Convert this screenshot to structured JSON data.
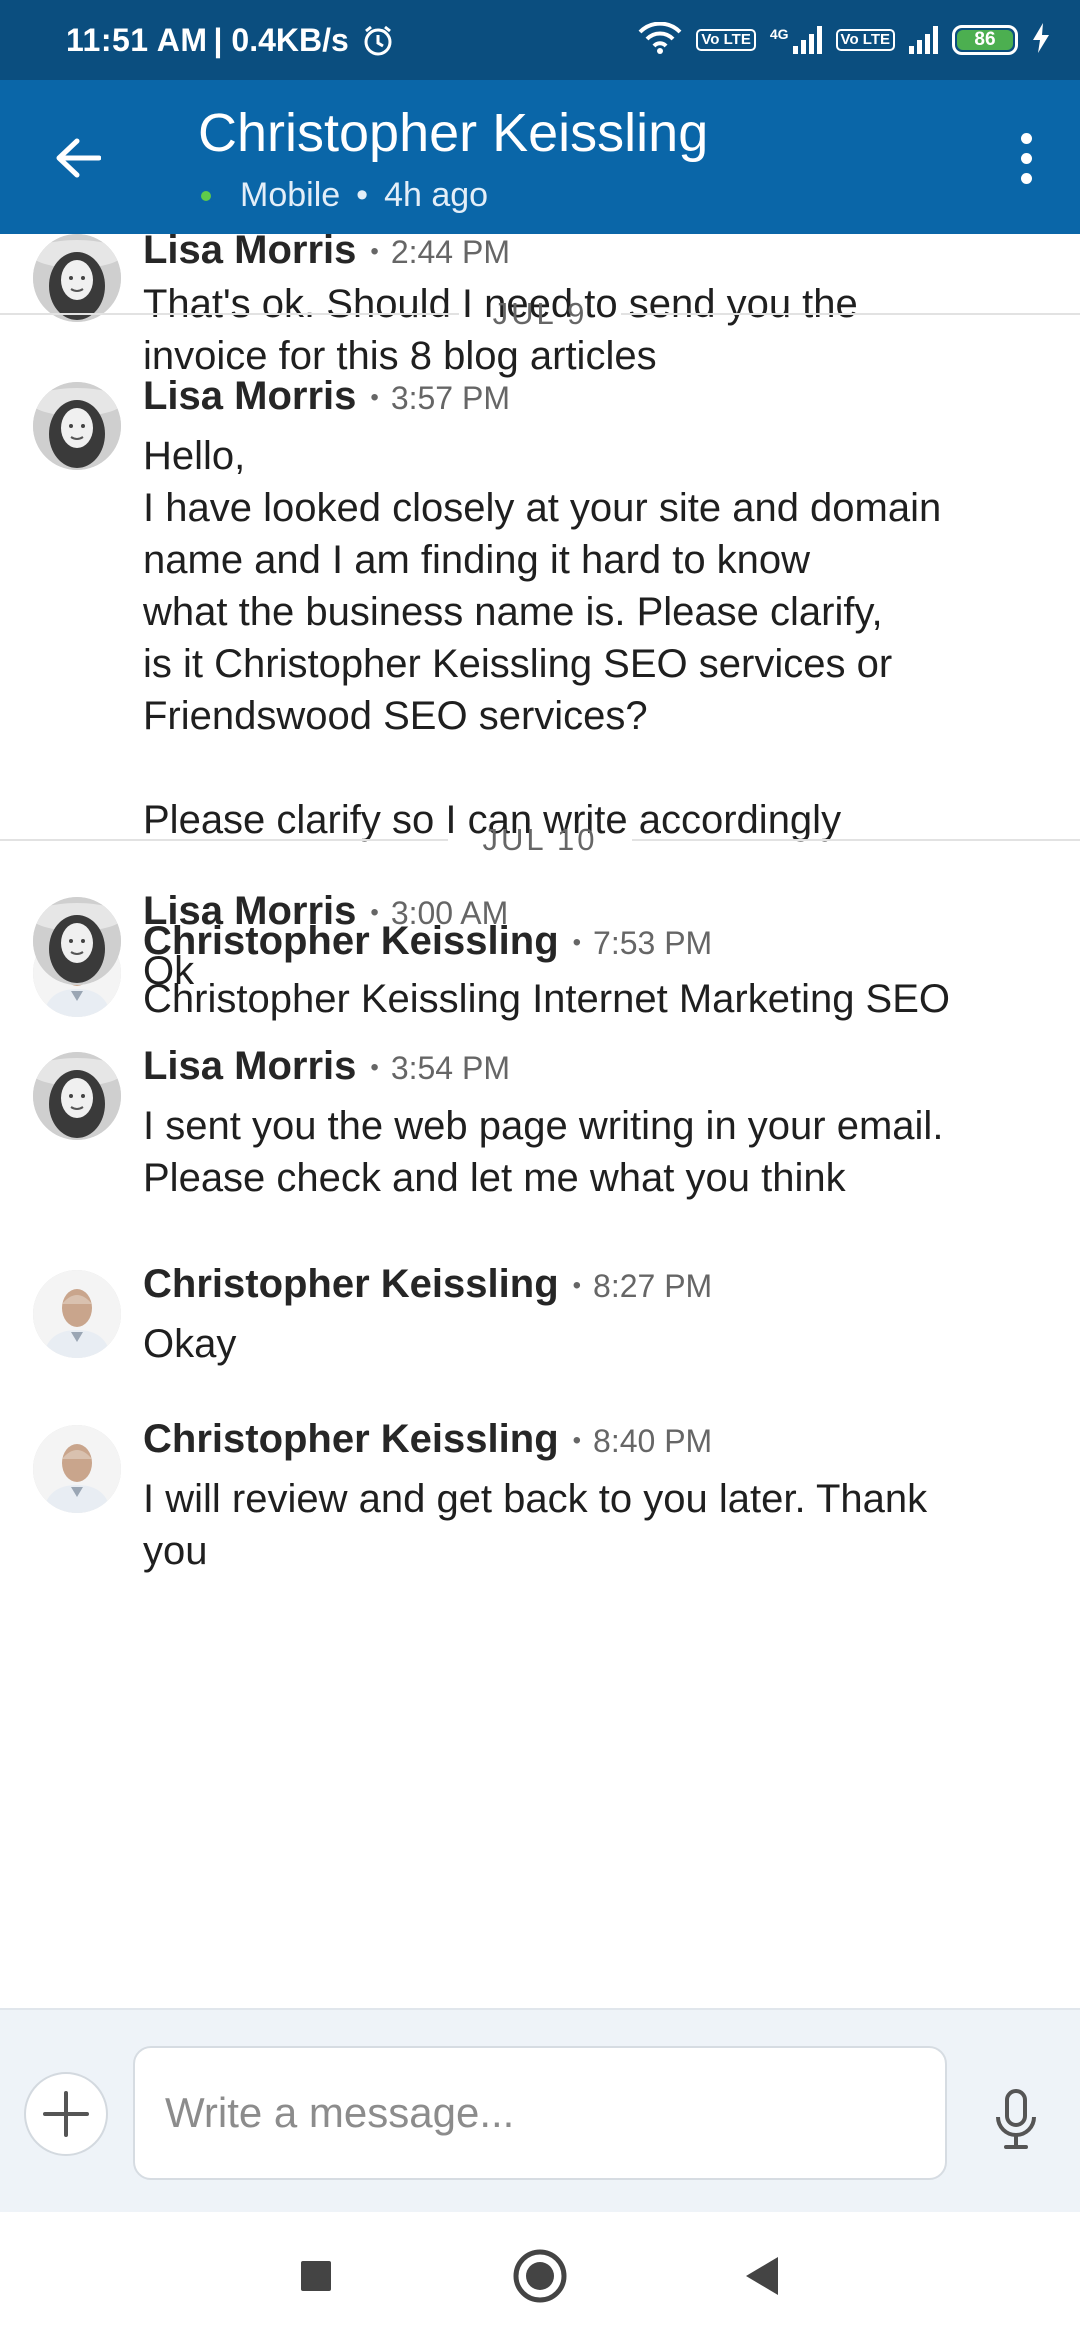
{
  "status_bar": {
    "time": "11:51 AM",
    "network_speed": "| 0.4KB/s",
    "sim1_label": "Vo LTE",
    "sim1_tech": "4G",
    "sim2_label": "Vo LTE",
    "battery_level": "86",
    "icons": [
      "alarm-icon",
      "wifi-icon",
      "signal-icon",
      "battery-icon",
      "charging-icon"
    ]
  },
  "header": {
    "name": "Christopher Keissling",
    "presence": "Mobile",
    "last_seen": "4h ago",
    "colors": {
      "appbar": "#0a66a8",
      "statusbar": "#0b4e7f",
      "online": "#5fca4a"
    }
  },
  "messages": [
    {
      "sender": "Lisa Morris",
      "time": "2:44 PM",
      "text": "That's ok. Should I need to send you the\ninvoice for this 8 blog articles"
    },
    {
      "day": "JUL 9"
    },
    {
      "sender": "Lisa Morris",
      "time": "3:57 PM",
      "text": "Hello,\nI have looked closely at your site and domain\nname and I am finding it hard to know\nwhat the business name is. Please clarify,\nis it Christopher Keissling SEO services or\nFriendswood SEO services?\n\nPlease clarify so I can write accordingly"
    },
    {
      "sender": "Christopher Keissling",
      "time": "7:53 PM",
      "text": "Christopher Keissling Internet Marketing SEO"
    },
    {
      "day": "JUL 10"
    },
    {
      "sender": "Lisa Morris",
      "time": "3:00 AM",
      "text": "Ok"
    },
    {
      "sender": "Lisa Morris",
      "time": "3:54 PM",
      "text": "I sent you the web page writing in your email.\nPlease check and let me what you think"
    },
    {
      "sender": "Christopher Keissling",
      "time": "8:27 PM",
      "text": "Okay"
    },
    {
      "sender": "Christopher Keissling",
      "time": "8:40 PM",
      "text": "I will review and get back to you later. Thank\nyou"
    }
  ],
  "composer": {
    "placeholder": "Write a message..."
  }
}
